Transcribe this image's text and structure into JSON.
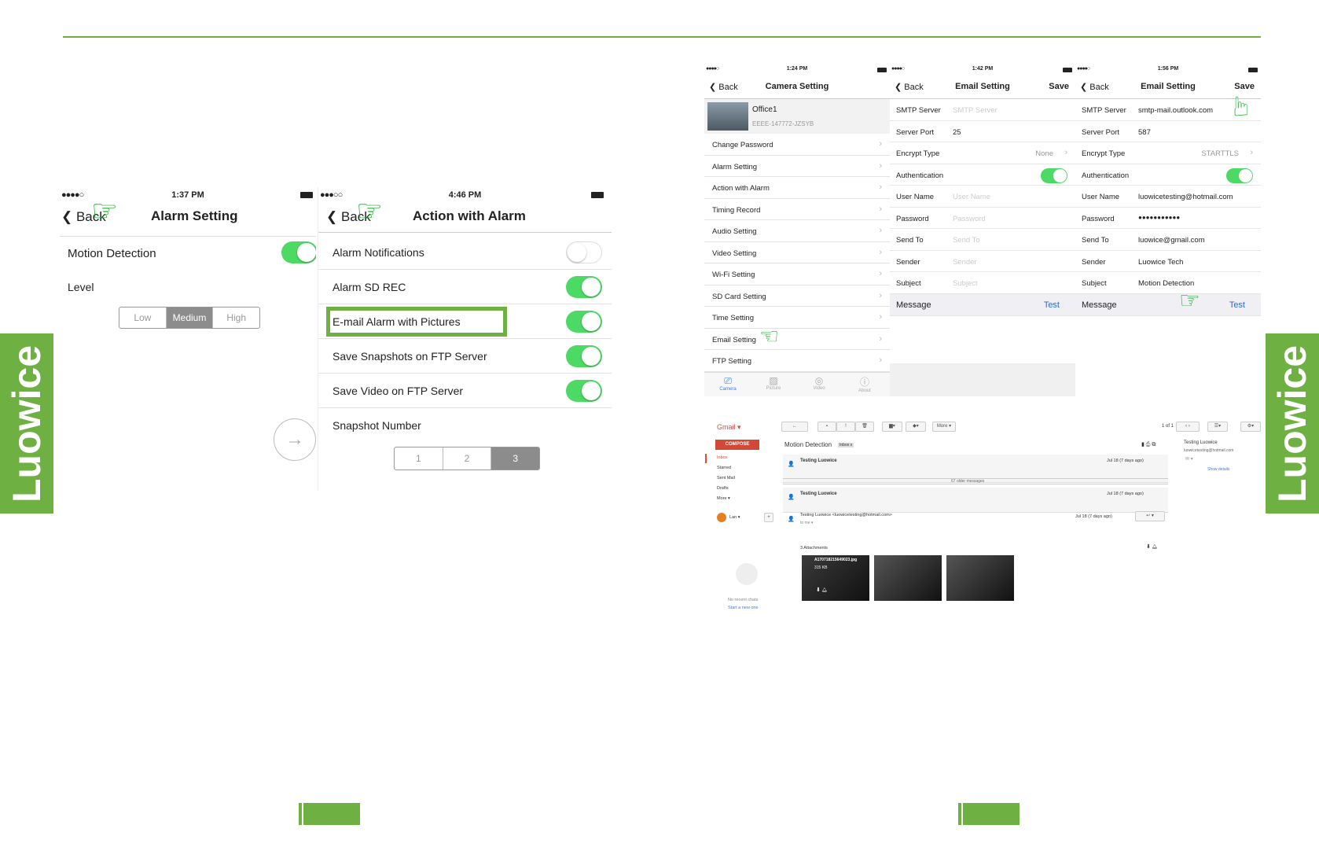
{
  "brand": "Luowice",
  "alarm_setting": {
    "status_time": "1:37 PM",
    "back": "Back",
    "title": "Alarm Setting",
    "motion_detection": "Motion Detection",
    "motion_on": true,
    "level_label": "Level",
    "levels": [
      "Low",
      "Medium",
      "High"
    ],
    "selected_level": "Medium"
  },
  "action_alarm": {
    "status_time": "4:46 PM",
    "back": "Back",
    "title": "Action with Alarm",
    "items": [
      {
        "label": "Alarm Notifications",
        "on": false
      },
      {
        "label": "Alarm SD REC",
        "on": true
      },
      {
        "label": "E-mail Alarm with Pictures",
        "on": true
      },
      {
        "label": "Save Snapshots on FTP Server",
        "on": true
      },
      {
        "label": "Save Video on FTP Server",
        "on": true
      }
    ],
    "snapshot_label": "Snapshot Number",
    "snapshot_options": [
      "1",
      "2",
      "3"
    ],
    "snapshot_selected": "3"
  },
  "camera_setting": {
    "status_time": "1:24 PM",
    "back": "Back",
    "title": "Camera Setting",
    "camera_name": "Office1",
    "camera_id": "EEEE-147772-JZSYB",
    "items": [
      "Change Password",
      "Alarm Setting",
      "Action with Alarm",
      "Timing Record",
      "Audio Setting",
      "Video Setting",
      "Wi-Fi Setting",
      "SD Card Setting",
      "Time Setting",
      "Email Setting",
      "FTP Setting"
    ],
    "tabs": [
      "Camera",
      "Picture",
      "Video",
      "About"
    ]
  },
  "email_empty": {
    "status_time": "1:42 PM",
    "back": "Back",
    "title": "Email Setting",
    "save": "Save",
    "rows": [
      {
        "label": "SMTP Server",
        "value": "SMTP Server",
        "placeholder": true
      },
      {
        "label": "Server Port",
        "value": "25",
        "placeholder": false
      },
      {
        "label": "Encrypt Type",
        "value": "None",
        "chevron": true
      },
      {
        "label": "Authentication",
        "toggle": true
      },
      {
        "label": "User Name",
        "value": "User Name",
        "placeholder": true
      },
      {
        "label": "Password",
        "value": "Password",
        "placeholder": true
      },
      {
        "label": "Send To",
        "value": "Send To",
        "placeholder": true
      },
      {
        "label": "Sender",
        "value": "Sender",
        "placeholder": true
      },
      {
        "label": "Subject",
        "value": "Subject",
        "placeholder": true
      }
    ],
    "message": "Message",
    "test": "Test"
  },
  "email_filled": {
    "status_time": "1:56 PM",
    "back": "Back",
    "title": "Email Setting",
    "save": "Save",
    "rows": [
      {
        "label": "SMTP Server",
        "value": "smtp-mail.outlook.com",
        "placeholder": false
      },
      {
        "label": "Server Port",
        "value": "587",
        "placeholder": false
      },
      {
        "label": "Encrypt Type",
        "value": "STARTTLS",
        "chevron": true
      },
      {
        "label": "Authentication",
        "toggle": true
      },
      {
        "label": "User Name",
        "value": "luowicetesting@hotmail.com",
        "placeholder": false
      },
      {
        "label": "Password",
        "value": "●●●●●●●●●●●",
        "placeholder": false
      },
      {
        "label": "Send To",
        "value": "luowice@gmail.com",
        "placeholder": false
      },
      {
        "label": "Sender",
        "value": "Luowice Tech",
        "placeholder": false
      },
      {
        "label": "Subject",
        "value": "Motion Detection",
        "placeholder": false
      }
    ],
    "message": "Message",
    "test": "Test"
  },
  "gmail": {
    "logo": "Gmail ▾",
    "compose": "COMPOSE",
    "nav": [
      "Inbox",
      "Starred",
      "Sent Mail",
      "Drafts",
      "More ▾"
    ],
    "user": "Lan ▾",
    "subject": "Motion Detection",
    "inbox_tag": "Inbox x",
    "pager": "1 of 1",
    "more": "More ▾",
    "threads": [
      {
        "sender": "Testing Luowice",
        "date": "Jul 18 (7 days ago)"
      },
      {
        "sender": "Testing Luowice",
        "date": "Jul 18 (7 days ago)"
      }
    ],
    "older": "67 older messages",
    "open_sender": "Testing Luowice <luowicetesting@hotmail.com>",
    "open_to": "to me ▾",
    "open_date": "Jul 18 (7 days ago)",
    "attachments_label": "3 Attachments",
    "attachment_name": "A170718215649023.jpg",
    "attachment_size": "315 KB",
    "contact_name": "Testing Luowice",
    "contact_email": "luowicetesting@hotmail.com",
    "show_details": "Show details",
    "no_chats": "No recent chats",
    "start_chat": "Start a new one"
  }
}
